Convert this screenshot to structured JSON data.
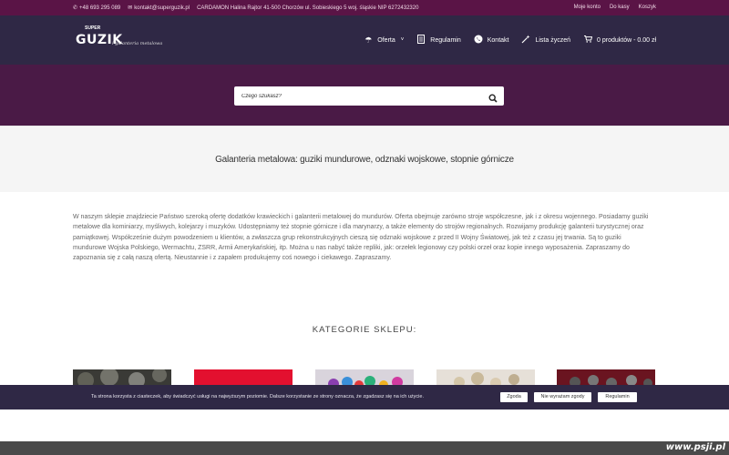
{
  "topbar": {
    "phone": "+48 693 295 089",
    "email": "kontakt@superguzik.pl",
    "address": "CARDAMON Halina Rajtor 41-500 Chorzów ul. Sobieskiego 5 woj. śląskie NIP 6272432320",
    "links": [
      "Moje konto",
      "Do kasy",
      "Koszyk"
    ]
  },
  "logo": {
    "super": "SUPER",
    "main": "GUZIK",
    "tagline": "i galanteria metalowa"
  },
  "nav": {
    "items": [
      {
        "label": "Oferta",
        "icon": "umbrella-icon"
      },
      {
        "label": "Regulamin",
        "icon": "document-icon"
      },
      {
        "label": "Kontakt",
        "icon": "whatsapp-icon"
      },
      {
        "label": "Lista życzeń",
        "icon": "magic-wand-icon"
      }
    ],
    "cart": "0 produktów - 0.00 zł"
  },
  "search": {
    "placeholder": "Czego szukasz?"
  },
  "page_title": "Galanteria metalowa: guziki mundurowe, odznaki wojskowe, stopnie górnicze",
  "intro": "W naszym sklepie znajdziecie Państwo szeroką ofertę dodatków krawieckich i galanterii metalowej do mundurów. Oferta obejmuje zarówno stroje współczesne, jak i z okresu wojennego. Posiadamy guziki metalowe dla kominiarzy, myśliwych, kolejarzy i muzyków. Udostępniamy też stopnie górnicze i dla marynarzy, a także elementy do strojów regionalnych. Rozwijamy produkcję galanterii turystycznej oraz pamiątkowej. Współcześnie dużym powodzeniem u klientów, a zwłaszcza grup rekonstrukcyjnych cieszą się odznaki wojskowe z przed II Wojny Światowej, jak też z czasu jej trwania. Są to guziki mundurowe Wojska Polskiego, Wermachtu, ZSRR, Armii Amerykańskiej, itp. Można u nas nabyć także repliki, jak: orzełek legionowy czy polski orzeł oraz kopie innego wyposażenia. Zapraszamy do zapoznania się z całą naszą ofertą. Nieustannie i z zapałem produkujemy coś nowego i ciekawego. Zapraszamy.",
  "categories_title": "KATEGORIE SKLEPU:",
  "cookie": {
    "text": "Ta strona korzysta z ciasteczek, aby świadczyć usługi na najwyższym poziomie. Dalsze korzystanie ze strony oznacza, że zgadzasz się na ich użycie.",
    "accept": "Zgoda",
    "decline": "Nie wyrażam zgody",
    "rules": "Regulamin"
  },
  "watermark": "www.psji.pl",
  "colors": {
    "topbar": "#5a1446",
    "header": "#2f2845",
    "hero": "#4a1a46",
    "cookie_bar": "#2f2845"
  }
}
